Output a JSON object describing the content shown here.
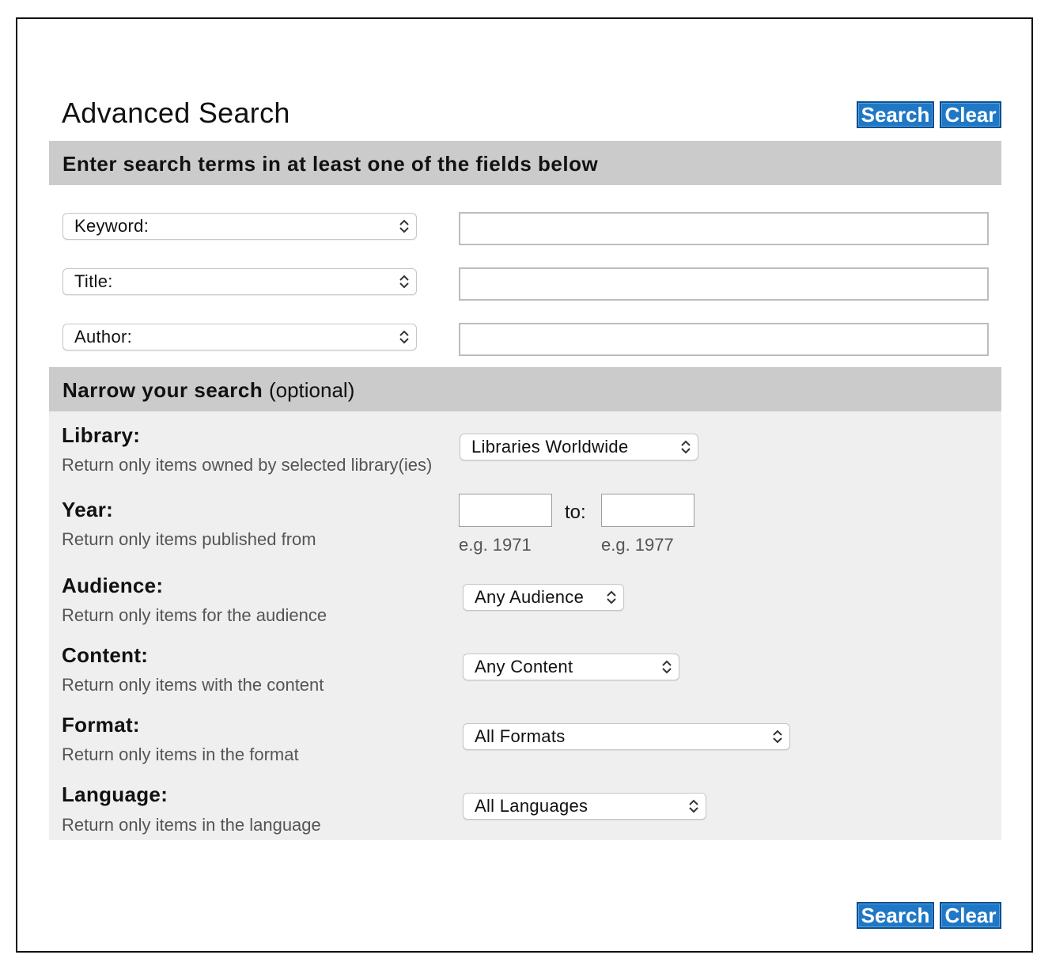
{
  "page": {
    "title": "Advanced Search"
  },
  "buttons": {
    "search_label": "Search",
    "clear_label": "Clear"
  },
  "terms_section": {
    "heading": "Enter search terms in at least one of the fields below",
    "rows": [
      {
        "field": "Keyword:",
        "value": ""
      },
      {
        "field": "Title:",
        "value": ""
      },
      {
        "field": "Author:",
        "value": ""
      }
    ]
  },
  "narrow_section": {
    "heading": "Narrow your search",
    "heading_suffix": "(optional)",
    "library": {
      "label": "Library:",
      "description": "Return only items owned by selected library(ies)",
      "selected": "Libraries Worldwide"
    },
    "year": {
      "label": "Year:",
      "description": "Return only items published from",
      "to_label": "to:",
      "from_value": "",
      "to_value": "",
      "from_hint": "e.g. 1971",
      "to_hint": "e.g. 1977"
    },
    "audience": {
      "label": "Audience:",
      "description": "Return only items for the audience",
      "selected": "Any Audience"
    },
    "content": {
      "label": "Content:",
      "description": "Return only items with the content",
      "selected": "Any Content"
    },
    "format": {
      "label": "Format:",
      "description": "Return only items in the format",
      "selected": "All Formats"
    },
    "language": {
      "label": "Language:",
      "description": "Return only items in the language",
      "selected": "All Languages"
    }
  },
  "colors": {
    "button_bg": "#1e78c6",
    "band_bg": "#cbcbcb",
    "narrow_bg": "#efefef"
  },
  "icons": {
    "select_chevron": "chevron-up-down-icon"
  }
}
